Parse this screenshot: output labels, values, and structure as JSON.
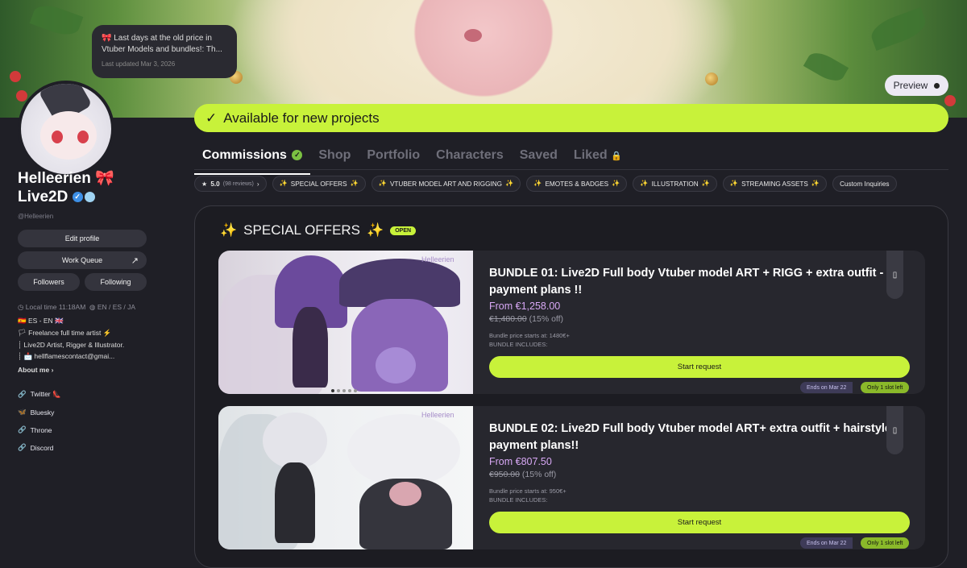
{
  "banner": {
    "preview_label": "Preview",
    "available_text": "Available for new projects"
  },
  "tooltip": {
    "text": "🎀 Last days at the old price in Vtuber Models and bundles!: Th...",
    "updated": "Last updated Mar 3, 2026"
  },
  "profile": {
    "name_line1": "Helleerien 🎀",
    "name_line2": "Live2D",
    "handle": "@Helleerien",
    "edit_profile": "Edit profile",
    "work_queue": "Work Queue",
    "followers": "Followers",
    "following": "Following",
    "local_time": "Local time 11:18AM",
    "languages": "EN / ES / JA",
    "bio": [
      "🇪🇸 ES - EN 🇬🇧",
      "🏳 Freelance full time artist ⚡",
      "┊  Live2D Artist, Rigger & Illustrator.",
      "┊  📩 hellflamescontact@gmai..."
    ],
    "about_me": "About me",
    "socials": [
      {
        "label": "Twitter 👠",
        "icon": "link-icon"
      },
      {
        "label": "Bluesky",
        "icon": "butterfly-icon"
      },
      {
        "label": "Throne",
        "icon": "link-icon"
      },
      {
        "label": "Discord",
        "icon": "link-icon"
      }
    ]
  },
  "tabs": [
    "Commissions",
    "Shop",
    "Portfolio",
    "Characters",
    "Saved",
    "Liked"
  ],
  "rating": {
    "score": "5.0",
    "reviews": "(98 reviews)"
  },
  "chips": [
    "SPECIAL OFFERS",
    "VTUBER MODEL ART AND RIGGING",
    "EMOTES & BADGES",
    "ILLUSTRATION",
    "STREAMING ASSETS"
  ],
  "chip_custom": "Custom Inquiries",
  "section": {
    "title": "SPECIAL OFFERS",
    "status": "OPEN"
  },
  "cards": [
    {
      "title": "BUNDLE 01: Live2D Full body Vtuber model ART + RIGG + extra outfit - payment plans !!",
      "price": "From €1,258.00",
      "old_price": "€1,480.00",
      "discount": "(15% off)",
      "note1": "Bundle price starts at: 1480€+",
      "note2": "BUNDLE INCLUDES:",
      "button": "Start request",
      "ends": "Ends on Mar 22",
      "slots": "Only 1 slot left",
      "watermark": "Helleerien"
    },
    {
      "title": "BUNDLE 02: Live2D Full body Vtuber model ART+ extra outfit + hairstyle - payment plans!!",
      "price": "From €807.50",
      "old_price": "€950.00",
      "discount": "(15% off)",
      "note1": "Bundle price starts at: 950€+",
      "note2": "BUNDLE INCLUDES:",
      "button": "Start request",
      "ends": "Ends on Mar 22",
      "slots": "Only 1 slot left",
      "watermark": "Helleerien"
    }
  ]
}
